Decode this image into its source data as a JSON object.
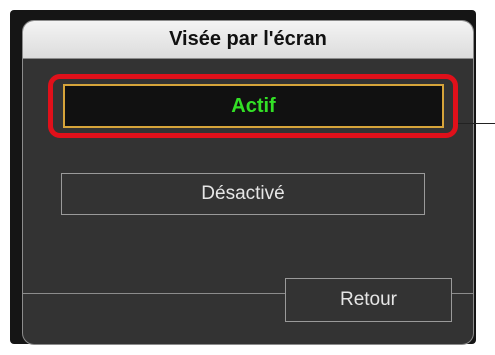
{
  "dialog": {
    "title": "Visée par l'écran",
    "options": [
      {
        "label": "Actif",
        "selected": true
      },
      {
        "label": "Désactivé",
        "selected": false
      }
    ],
    "back_label": "Retour"
  },
  "colors": {
    "selected_text": "#33e026",
    "selected_border": "#d6a43a",
    "highlight": "#e0101a",
    "panel_bg": "#333333"
  }
}
